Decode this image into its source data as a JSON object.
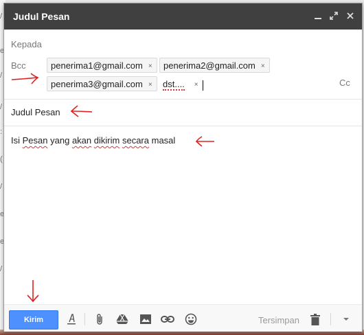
{
  "compose": {
    "title": "Judul Pesan",
    "icons": {
      "minimize": "minimize-icon",
      "expand": "expand-icon",
      "close": "close-icon"
    },
    "to_label": "Kepada",
    "bcc_label": "Bcc",
    "cc_label": "Cc",
    "recipients": [
      "penerima1@gmail.com",
      "penerima2@gmail.com",
      "penerima3@gmail.com"
    ],
    "extra_recipient": "dst....",
    "chip_remove_glyph": "×",
    "subject": "Judul Pesan",
    "body": {
      "w1": "Isi",
      "w2": "Pesan",
      "w3": "yang",
      "w4": "akan",
      "w5": "dikirim",
      "w6": "secara",
      "w7": "masal"
    }
  },
  "toolbar": {
    "send_label": "Kirim",
    "saved_label": "Tersimpan",
    "icons": [
      "text-format-icon",
      "attach-icon",
      "drive-icon",
      "photo-icon",
      "link-icon",
      "emoji-icon",
      "trash-icon",
      "more-options-icon"
    ]
  },
  "colors": {
    "titlebar": "#404040",
    "send_button": "#4d90fe",
    "annotation": "#e02020"
  }
}
